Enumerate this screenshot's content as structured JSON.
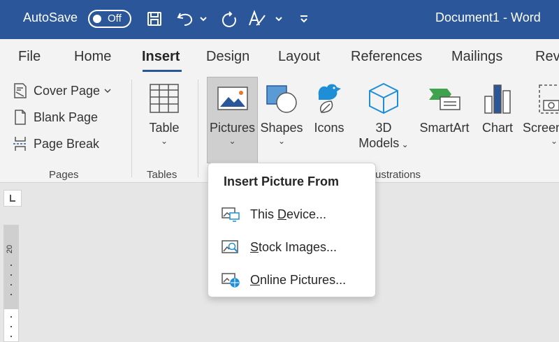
{
  "titlebar": {
    "autosave_label": "AutoSave",
    "autosave_state": "Off",
    "document_title": "Document1  -  Word",
    "background_color": "#2b579a",
    "quick_access": [
      "save-icon",
      "undo-icon",
      "redo-icon",
      "text-effects-icon",
      "customize-qat-icon"
    ]
  },
  "tabs": [
    {
      "label": "File"
    },
    {
      "label": "Home"
    },
    {
      "label": "Insert",
      "active": true
    },
    {
      "label": "Design"
    },
    {
      "label": "Layout"
    },
    {
      "label": "References"
    },
    {
      "label": "Mailings"
    },
    {
      "label": "Rev"
    }
  ],
  "ribbon": {
    "pages": {
      "cover_page": "Cover Page",
      "blank_page": "Blank Page",
      "page_break": "Page Break",
      "group_label": "Pages"
    },
    "tables": {
      "table": "Table",
      "group_label": "Tables"
    },
    "illustrations": {
      "pictures": "Pictures",
      "shapes": "Shapes",
      "icons": "Icons",
      "models_line1": "3D",
      "models_line2": "Models",
      "smartart": "SmartArt",
      "chart": "Chart",
      "screenshot": "Screen",
      "group_label": "ustrations"
    }
  },
  "ruler": {
    "vertical_number": "20"
  },
  "dropdown": {
    "header": "Insert Picture From",
    "items": [
      {
        "label_pre": "This ",
        "accel": "D",
        "label_post": "evice...",
        "icon": "this-device-icon"
      },
      {
        "label_pre": "",
        "accel": "S",
        "label_post": "tock Images...",
        "icon": "stock-images-icon"
      },
      {
        "label_pre": "",
        "accel": "O",
        "label_post": "nline Pictures...",
        "icon": "online-pictures-icon"
      }
    ]
  },
  "colors": {
    "accent": "#2b579a",
    "smartart_green": "#3fa34d",
    "icons_blue": "#1e8fd6"
  }
}
